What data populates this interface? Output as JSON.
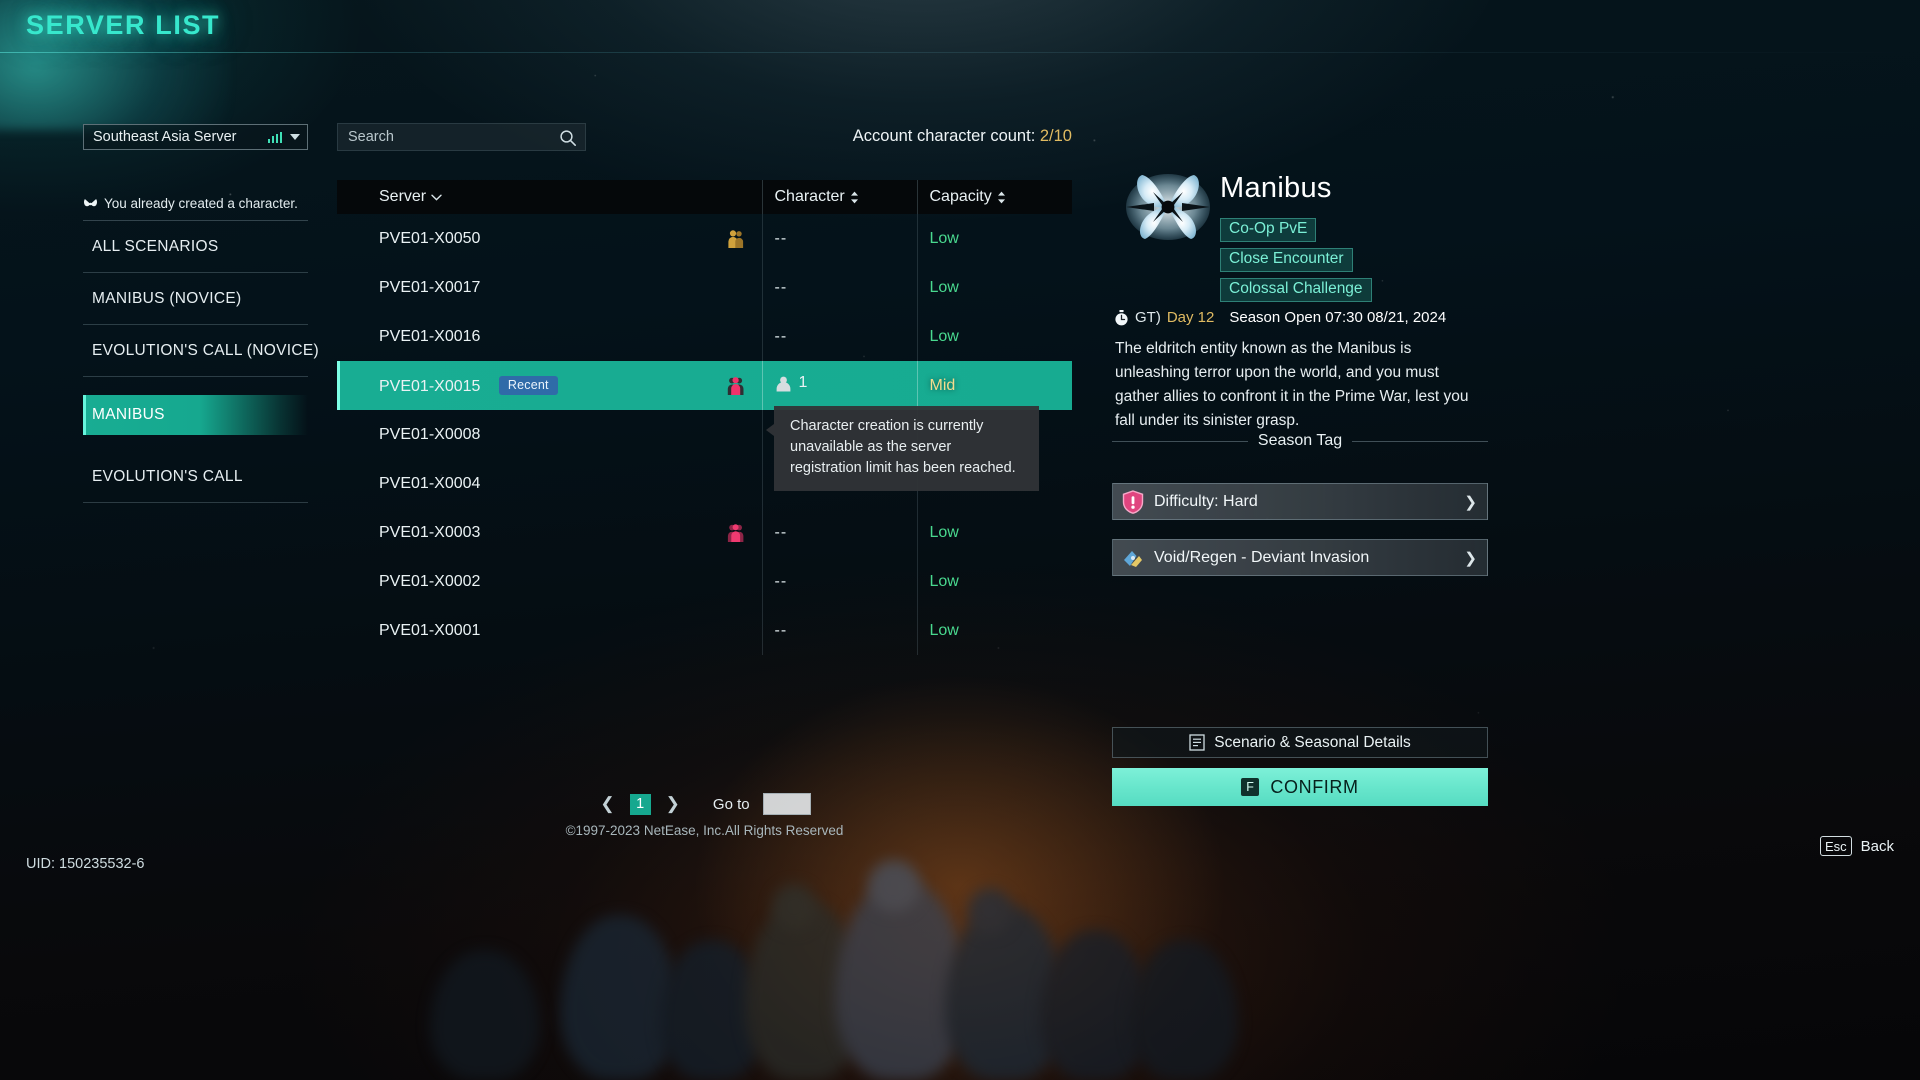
{
  "header": {
    "title": "SERVER LIST"
  },
  "sidebar": {
    "region": {
      "label": "Southeast Asia Server",
      "signal_icon": "signal-bars-icon",
      "caret_icon": "chevron-down-icon"
    },
    "notice": {
      "icon": "butterfly-icon",
      "text": "You already created a character."
    },
    "items": [
      {
        "label": "ALL SCENARIOS",
        "active": false
      },
      {
        "label": "MANIBUS (NOVICE)",
        "active": false
      },
      {
        "label": "EVOLUTION'S CALL (NOVICE)",
        "active": false
      },
      {
        "label": "MANIBUS",
        "active": true
      },
      {
        "label": "EVOLUTION'S CALL",
        "active": false
      }
    ]
  },
  "center": {
    "search": {
      "placeholder": "Search",
      "icon": "search-icon"
    },
    "account_count_label": "Account character count: ",
    "account_count_value": "2/10",
    "columns": [
      {
        "key": "server",
        "label": "Server",
        "sort_icon": "chevron-down-icon"
      },
      {
        "key": "character",
        "label": "Character",
        "sort_icon": "sort-updown-icon"
      },
      {
        "key": "capacity",
        "label": "Capacity",
        "sort_icon": "sort-updown-icon"
      }
    ],
    "rows": [
      {
        "server": "PVE01-X0050",
        "badge": "",
        "pop_icon": "people-gold-icon",
        "character": "--",
        "capacity": "Low",
        "capacity_level": "low",
        "selected": false
      },
      {
        "server": "PVE01-X0017",
        "badge": "",
        "pop_icon": "",
        "character": "--",
        "capacity": "Low",
        "capacity_level": "low",
        "selected": false
      },
      {
        "server": "PVE01-X0016",
        "badge": "",
        "pop_icon": "",
        "character": "--",
        "capacity": "Low",
        "capacity_level": "low",
        "selected": false
      },
      {
        "server": "PVE01-X0015",
        "badge": "Recent",
        "pop_icon": "people-pink-icon",
        "character": "1",
        "capacity": "Mid",
        "capacity_level": "mid",
        "selected": true
      },
      {
        "server": "PVE01-X0008",
        "badge": "",
        "pop_icon": "",
        "character": "",
        "capacity": "",
        "capacity_level": "none",
        "selected": false
      },
      {
        "server": "PVE01-X0004",
        "badge": "",
        "pop_icon": "",
        "character": "",
        "capacity": "",
        "capacity_level": "none",
        "selected": false
      },
      {
        "server": "PVE01-X0003",
        "badge": "",
        "pop_icon": "people-pink-icon",
        "character": "--",
        "capacity": "Low",
        "capacity_level": "low",
        "selected": false
      },
      {
        "server": "PVE01-X0002",
        "badge": "",
        "pop_icon": "",
        "character": "--",
        "capacity": "Low",
        "capacity_level": "low",
        "selected": false
      },
      {
        "server": "PVE01-X0001",
        "badge": "",
        "pop_icon": "",
        "character": "--",
        "capacity": "Low",
        "capacity_level": "low",
        "selected": false
      }
    ],
    "tooltip": "Character creation is currently unavailable as the server registration limit has been reached.",
    "pager": {
      "prev_icon": "chevron-left-icon",
      "page": "1",
      "next_icon": "chevron-right-icon",
      "goto_label": "Go to",
      "goto_value": ""
    },
    "copyright": "©1997-2023 NetEase, Inc.All Rights Reserved"
  },
  "detail": {
    "logo_icon": "butterfly-emblem-icon",
    "name": "Manibus",
    "tags": [
      "Co-Op PvE",
      "Close Encounter",
      "Colossal Challenge"
    ],
    "season": {
      "clock_icon": "stopwatch-icon",
      "gt_label": "GT)",
      "day": "Day 12",
      "open": "Season Open 07:30 08/21, 2024"
    },
    "description": "The eldritch entity known as the Manibus is unleashing terror upon the world, and you must gather allies to confront it in the Prime War, lest you fall under its sinister grasp.",
    "season_tag_heading": "Season Tag",
    "buttons": [
      {
        "icon": "shield-alert-icon",
        "label": "Difficulty: Hard",
        "chev": "chevron-right-icon"
      },
      {
        "icon": "portal-icon",
        "label": "Void/Regen - Deviant Invasion",
        "chev": "chevron-right-icon"
      }
    ],
    "details_button": {
      "icon": "document-icon",
      "label": "Scenario & Seasonal Details"
    },
    "confirm_button": {
      "key": "F",
      "label": "CONFIRM"
    }
  },
  "footer": {
    "uid": "UID: 150235532-6",
    "back": {
      "key": "Esc",
      "label": "Back"
    }
  },
  "colors": {
    "accent_teal": "#16a88f",
    "title_glow": "#37e8cd",
    "gold": "#e0bb62",
    "low_green": "#49d98f",
    "badge_blue": "#2f6ba8"
  }
}
